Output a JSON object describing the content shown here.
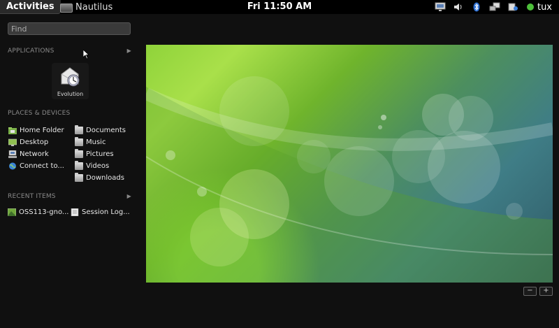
{
  "topbar": {
    "activities": "Activities",
    "app_menu": "Nautilus",
    "clock": "Fri 11:50 AM",
    "user": "tux",
    "tray_icons": [
      "display-icon",
      "volume-icon",
      "bluetooth-icon",
      "network-icon",
      "accessibility-icon"
    ]
  },
  "search": {
    "placeholder": "Find"
  },
  "applications": {
    "header": "APPLICATIONS",
    "items": [
      {
        "label": "Evolution",
        "icon": "evolution-icon"
      }
    ]
  },
  "places": {
    "header": "PLACES & DEVICES",
    "col1": [
      "Home Folder",
      "Desktop",
      "Network",
      "Connect to..."
    ],
    "col2": [
      "Documents",
      "Music",
      "Pictures",
      "Videos",
      "Downloads"
    ]
  },
  "recent": {
    "header": "RECENT ITEMS",
    "items": [
      "OSS113-gno...",
      "Session Log..."
    ]
  },
  "workspace_controls": {
    "minus": "−",
    "plus": "+"
  },
  "colors": {
    "user_status": "#4dbf3a",
    "topbar": "#000000",
    "wallpaper_green": "#8fd33a",
    "wallpaper_teal": "#3f7d86"
  }
}
